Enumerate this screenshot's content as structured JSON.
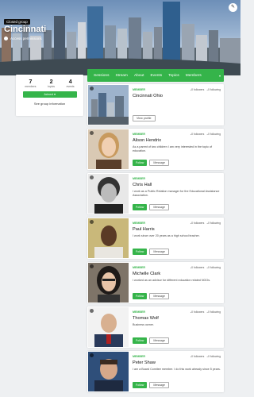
{
  "hero": {
    "tag": "Closed group",
    "title": "Cincinnati",
    "permissions": "Access permissions"
  },
  "nav": {
    "items": [
      "Sessions",
      "Stream",
      "About",
      "Events",
      "Topics",
      "Members"
    ],
    "more": "▾"
  },
  "stats": {
    "items": [
      {
        "num": "7",
        "label": "members"
      },
      {
        "num": "2",
        "label": "topics"
      },
      {
        "num": "4",
        "label": "events"
      }
    ],
    "join_label": "Joined ▾",
    "info_link": "See group information"
  },
  "members": [
    {
      "role": "MEMBER",
      "followers": "0 followers",
      "following": "0 following",
      "name": "Cincinnati Ohio",
      "bio": "",
      "actions": [
        "View profile"
      ]
    },
    {
      "role": "MEMBER",
      "followers": "0 followers",
      "following": "0 following",
      "name": "Alison Hendrix",
      "bio": "As a parent of two children I am very interested in the topic of education.",
      "actions": [
        "Follow",
        "Message"
      ]
    },
    {
      "role": "MEMBER",
      "followers": "",
      "following": "",
      "name": "Chris Hall",
      "bio": "I work as a Public Relation manager for the Educational Assistance Association.",
      "actions": [
        "Follow",
        "Message"
      ]
    },
    {
      "role": "MEMBER",
      "followers": "0 followers",
      "following": "0 following",
      "name": "Paul Harris",
      "bio": "I work since over 20 years as a high school teacher.",
      "actions": [
        "Follow",
        "Message"
      ]
    },
    {
      "role": "MEMBER",
      "followers": "0 followers",
      "following": "0 following",
      "name": "Michelle Clark",
      "bio": "I worked as an advisor for different education related NGOs.",
      "actions": [
        "Follow",
        "Message"
      ]
    },
    {
      "role": "MEMBER",
      "followers": "0 followers",
      "following": "0 following",
      "name": "Thomas Wolf",
      "bio": "Business owner.",
      "actions": [
        "Follow",
        "Message"
      ]
    },
    {
      "role": "MEMBER",
      "followers": "0 followers",
      "following": "0 following",
      "name": "Peter Shaw",
      "bio": "I am a Board Comitee member. I do this work already since 5 years.",
      "actions": [
        "Follow",
        "Message"
      ]
    }
  ],
  "colors": {
    "accent": "#35b44a"
  }
}
